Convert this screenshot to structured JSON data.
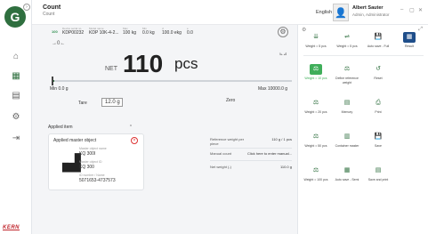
{
  "app": {
    "title": "Count",
    "subtitle": "Count"
  },
  "header": {
    "language": "English ⌄",
    "user_name": "Albert Sauter",
    "user_role": "Admin, Administrator",
    "minimize": "–",
    "maximize": "▢",
    "close": "✕"
  },
  "device": {
    "status_badge": "100",
    "columns": [
      {
        "label": "Device serial no.",
        "value": "KDP00232"
      },
      {
        "label": "Model name",
        "value": "KDP 10K-4-2..."
      },
      {
        "label": "Max",
        "value": "100 kg"
      },
      {
        "label": "Min",
        "value": "0.0 kg"
      },
      {
        "label": "d",
        "value": "100.0 ekg"
      },
      {
        "label": "e",
        "value": "0.0"
      }
    ]
  },
  "indicators": {
    "zero": "→0←",
    "stable": "⊾⊿"
  },
  "weight": {
    "net_label": "NET",
    "value": "110",
    "unit": "pcs"
  },
  "range": {
    "min": "Min  0.0 g",
    "max": "Max  10000.0 g",
    "fill_percent": 1.1
  },
  "tare": {
    "label": "Tare",
    "value": "12.0  g",
    "zero_label": "Zero"
  },
  "applied_item": {
    "section_title": "Applied item",
    "chevron": "⌃",
    "card_title": "Applied master object",
    "fields": [
      {
        "label": "Master object name",
        "value": "KQ 300I"
      },
      {
        "label": "Master object ID",
        "value": "KQ 300"
      },
      {
        "label": "ID number / Name",
        "value": "5071653-4737573"
      }
    ]
  },
  "info": [
    {
      "label": "Reference weight per piece",
      "value": "110 g / 1 pcs"
    },
    {
      "label": "Manual count",
      "value": "Click here to enter manual..."
    },
    {
      "label": "Net weight (-)",
      "value": "110.0 g"
    }
  ],
  "panel": {
    "top_buttons": [
      {
        "label": "Weight = 5 pcs",
        "icon": "⇊"
      },
      {
        "label": "Weight = 5 pcs",
        "icon": "⇌"
      },
      {
        "label": "Auto save - Full",
        "icon": "💾"
      },
      {
        "label": "Result",
        "icon": "▦"
      }
    ],
    "rows": [
      [
        {
          "label": "Weight = 10 pcs",
          "icon": "⚖"
        },
        {
          "label": "Define reference weight",
          "icon": "⚖"
        },
        {
          "label": "Reset",
          "icon": "↺"
        }
      ],
      [
        {
          "label": "Weight = 20 pcs",
          "icon": "⚖"
        },
        {
          "label": "Memory",
          "icon": "▤"
        },
        {
          "label": "Print",
          "icon": "⎙"
        }
      ],
      [
        {
          "label": "Weight = 50 pcs",
          "icon": "⚖"
        },
        {
          "label": "Container master",
          "icon": "▥"
        },
        {
          "label": "Save",
          "icon": "💾"
        }
      ],
      [
        {
          "label": "Weight = 100 pcs",
          "icon": "⚖"
        },
        {
          "label": "Auto save - Semi",
          "icon": "▦"
        },
        {
          "label": "Save and print",
          "icon": "▤"
        }
      ]
    ]
  },
  "brand": "KERN",
  "colors": {
    "accent": "#2f6f3f",
    "active_green": "#3fae5a",
    "active_blue": "#1f4e8a",
    "close_red": "#dd3333"
  }
}
